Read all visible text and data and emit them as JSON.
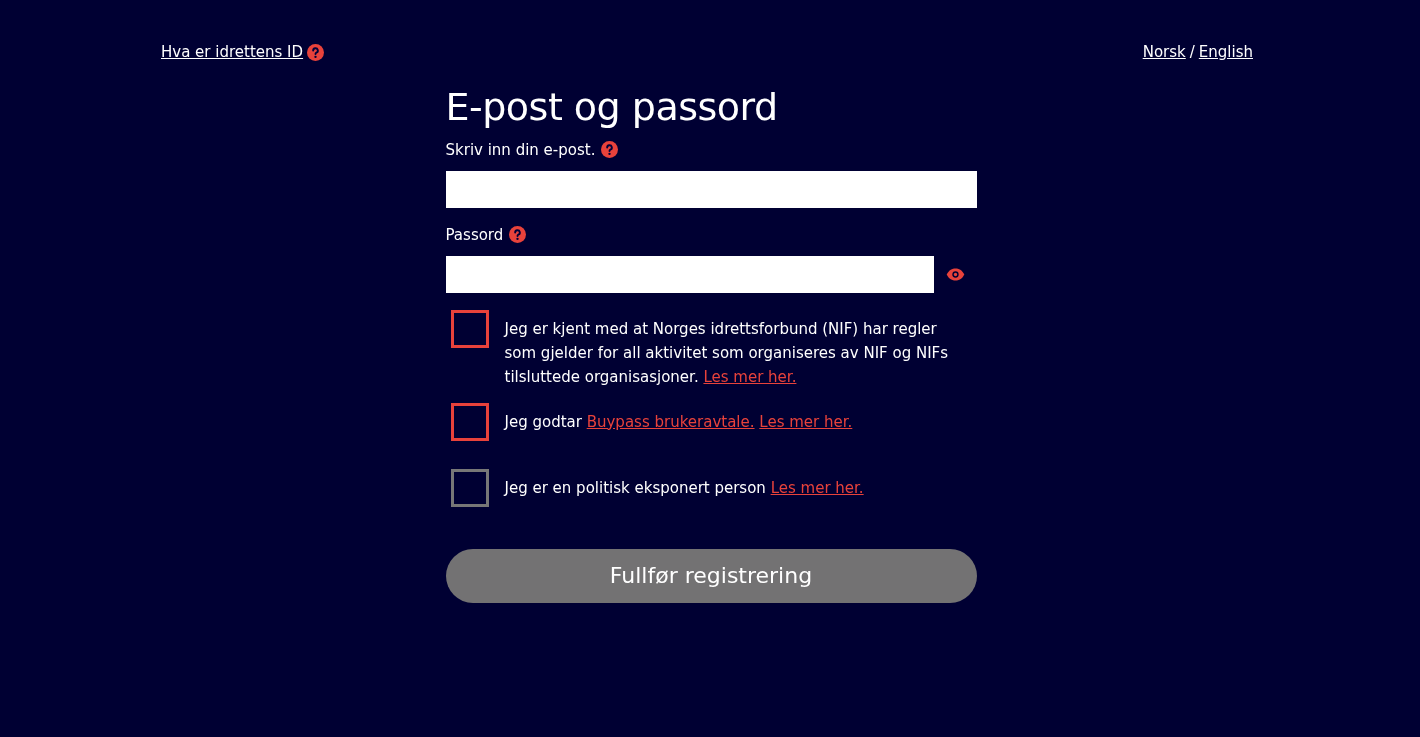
{
  "header": {
    "help_link": "Hva er idrettens ID",
    "languages": [
      "Norsk",
      "English"
    ],
    "language_separator": "/"
  },
  "title": "E-post og passord",
  "email": {
    "label": "Skriv inn din e-post."
  },
  "password": {
    "label": "Passord"
  },
  "checkboxes": [
    {
      "checked": false,
      "color": "#e8423b",
      "parts": [
        {
          "kind": "text",
          "text": "Jeg er kjent med at Norges idrettsforbund (NIF) har regler som gjelder for all aktivitet som organiseres av NIF og NIFs tilsluttede organisasjoner."
        },
        {
          "kind": "link",
          "text": "Les mer her."
        }
      ]
    },
    {
      "checked": false,
      "color": "#e8423b",
      "parts": [
        {
          "kind": "text",
          "text": "Jeg godtar"
        },
        {
          "kind": "link",
          "text": "Buypass brukeravtale."
        },
        {
          "kind": "link",
          "text": "Les mer her."
        }
      ]
    },
    {
      "checked": false,
      "color": "#777777",
      "parts": [
        {
          "kind": "text",
          "text": "Jeg er en politisk eksponert person"
        },
        {
          "kind": "link",
          "text": "Les mer her."
        }
      ]
    }
  ],
  "submit": {
    "label": "Fullfør registrering",
    "disabled": true
  }
}
